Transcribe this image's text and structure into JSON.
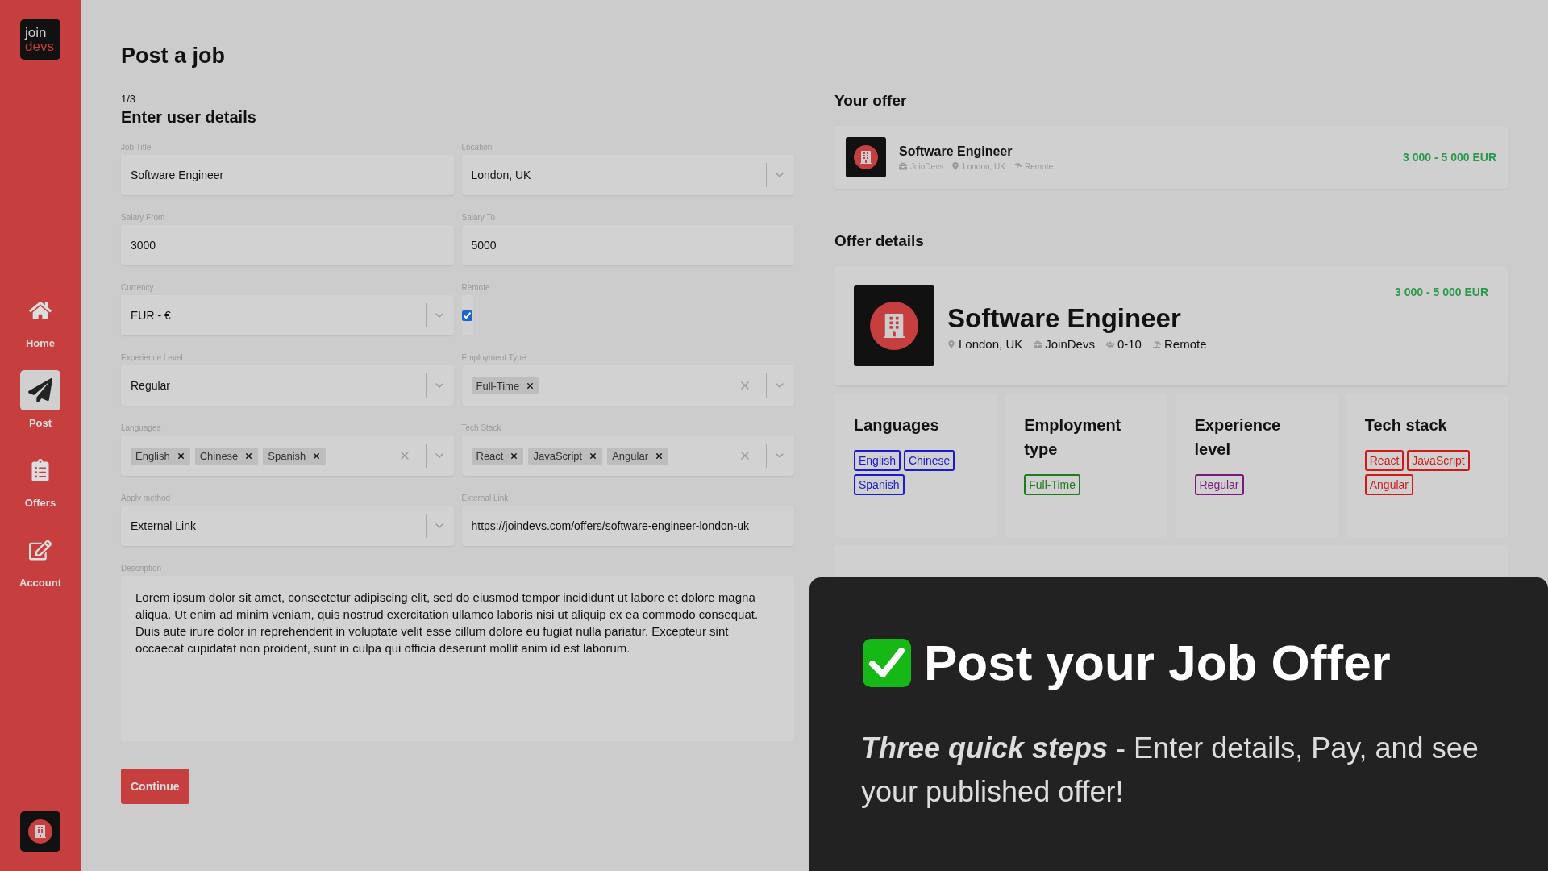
{
  "sidebar": {
    "logo": {
      "line1": "join",
      "line2": "devs"
    },
    "items": [
      {
        "kind": "home",
        "label": "Home",
        "selected": false
      },
      {
        "kind": "post",
        "label": "Post",
        "selected": true
      },
      {
        "kind": "offers",
        "label": "Offers",
        "selected": false
      },
      {
        "kind": "account",
        "label": "Account",
        "selected": false
      }
    ]
  },
  "form": {
    "title": "Post a job",
    "step": "1/3",
    "heading": "Enter user details",
    "fields": [
      {
        "kind": "text",
        "label": "Job Title",
        "value": "Software Engineer"
      },
      {
        "kind": "select",
        "label": "Location",
        "value": "London, UK"
      },
      {
        "kind": "text",
        "label": "Salary From",
        "value": "3000"
      },
      {
        "kind": "text",
        "label": "Salary To",
        "value": "5000"
      },
      {
        "kind": "select",
        "label": "Currency",
        "value": "EUR - €"
      },
      {
        "kind": "checkbox",
        "label": "Remote",
        "checked": true
      },
      {
        "kind": "select",
        "label": "Experience Level",
        "value": "Regular"
      },
      {
        "kind": "multi",
        "label": "Employment Type",
        "tags": [
          "Full-Time"
        ]
      },
      {
        "kind": "multi",
        "label": "Languages",
        "tags": [
          "English",
          "Chinese",
          "Spanish"
        ]
      },
      {
        "kind": "multi",
        "label": "Tech Stack",
        "tags": [
          "React",
          "JavaScript",
          "Angular"
        ]
      },
      {
        "kind": "select",
        "label": "Apply method",
        "value": "External Link"
      },
      {
        "kind": "text",
        "label": "External Link",
        "value": "https://joindevs.com/offers/software-engineer-london-uk"
      },
      {
        "kind": "textarea",
        "label": "Description",
        "value": "Lorem ipsum dolor sit amet, consectetur adipiscing elit, sed do eiusmod tempor incididunt ut labore et dolore magna aliqua. Ut enim ad minim veniam, quis nostrud exercitation ullamco laboris nisi ut aliquip ex ea commodo consequat. Duis aute irure dolor in reprehenderit in voluptate velit esse cillum dolore eu fugiat nulla pariatur. Excepteur sint occaecat cupidatat non proident, sunt in culpa qui officia deserunt mollit anim id est laborum."
      }
    ],
    "button": "Continue"
  },
  "preview": {
    "your_offer": {
      "heading": "Your offer",
      "title": "Software Engineer",
      "company": "JoinDevs",
      "location": "London, UK",
      "work_mode": "Remote",
      "salary": "3 000 - 5 000 EUR"
    },
    "offer_details": {
      "heading": "Offer details",
      "title": "Software Engineer",
      "location": "London, UK",
      "company": "JoinDevs",
      "team_size": "0-10",
      "work_mode": "Remote",
      "salary": "3 000 - 5 000 EUR",
      "sections": [
        {
          "title": "Languages",
          "color": "#1a1ad0",
          "tags": [
            "English",
            "Chinese",
            "Spanish"
          ]
        },
        {
          "title": "Employment type",
          "color": "#1d7a1d",
          "tags": [
            "Full-Time"
          ]
        },
        {
          "title": "Experience level",
          "color": "#7a1a7a",
          "tags": [
            "Regular"
          ]
        },
        {
          "title": "Tech stack",
          "color": "#d01a1a",
          "tags": [
            "React",
            "JavaScript",
            "Angular"
          ]
        }
      ]
    }
  },
  "banner": {
    "title": "Post your Job Offer",
    "subtitle": "**Three quick steps** - Enter details, Pay, and see your published offer!"
  }
}
